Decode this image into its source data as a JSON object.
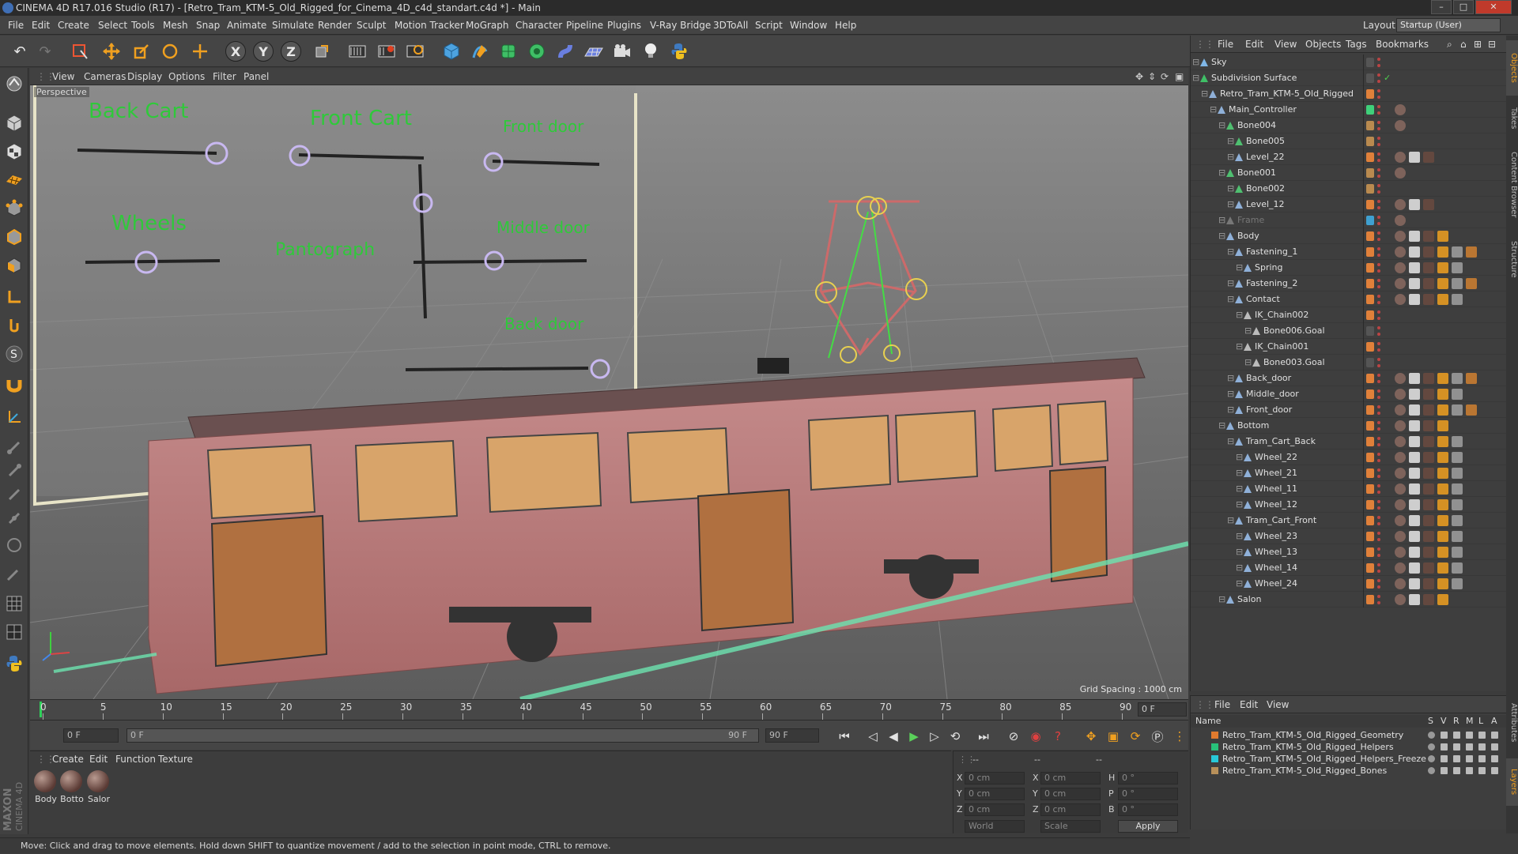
{
  "window": {
    "title": "CINEMA 4D R17.016 Studio (R17) - [Retro_Tram_KTM-5_Old_Rigged_for_Cinema_4D_c4d_standart.c4d *] - Main",
    "minimize": "–",
    "maximize": "□",
    "close": "✕"
  },
  "menu": {
    "items": [
      "File",
      "Edit",
      "Create",
      "Select",
      "Tools",
      "Mesh",
      "Snap",
      "Animate",
      "Simulate",
      "Render",
      "Sculpt",
      "Motion Tracker",
      "MoGraph",
      "Character",
      "Pipeline",
      "Plugins",
      "V-Ray Bridge",
      "3DToAll",
      "Script",
      "Window",
      "Help"
    ],
    "layout_label": "Layout:",
    "layout_value": "Startup (User)"
  },
  "toolbar": {
    "undo": "↶",
    "redo": "↷",
    "x_axis": "X",
    "y_axis": "Y",
    "z_axis": "Z"
  },
  "viewport": {
    "menu": [
      "View",
      "Cameras",
      "Display",
      "Options",
      "Filter",
      "Panel"
    ],
    "label": "Perspective",
    "grid_spacing": "Grid Spacing : 1000 cm",
    "controls": {
      "back_cart": "Back Cart",
      "front_cart": "Front Cart",
      "front_door": "Front door",
      "wheels": "Wheels",
      "pantograph": "Pantograph",
      "middle_door": "Middle door",
      "back_door": "Back door"
    }
  },
  "timeline": {
    "ticks": [
      "0",
      "5",
      "10",
      "15",
      "20",
      "25",
      "30",
      "35",
      "40",
      "45",
      "50",
      "55",
      "60",
      "65",
      "70",
      "75",
      "80",
      "85",
      "90"
    ],
    "current_frame": "0 F"
  },
  "playbar": {
    "start_field": "0 F",
    "range_start": "0 F",
    "range_end": "90 F",
    "end_field": "90 F"
  },
  "materials": {
    "menu": [
      "Create",
      "Edit",
      "Function",
      "Texture"
    ],
    "items": [
      "Body",
      "Botto",
      "Salor"
    ]
  },
  "coordinates": {
    "header1": "--",
    "header2": "--",
    "header3": "--",
    "rows": [
      {
        "l1": "X",
        "v1": "0 cm",
        "l2": "X",
        "v2": "0 cm",
        "l3": "H",
        "v3": "0 °"
      },
      {
        "l1": "Y",
        "v1": "0 cm",
        "l2": "Y",
        "v2": "0 cm",
        "l3": "P",
        "v3": "0 °"
      },
      {
        "l1": "Z",
        "v1": "0 cm",
        "l2": "Z",
        "v2": "0 cm",
        "l3": "B",
        "v3": "0 °"
      }
    ],
    "space": "World",
    "mode": "Scale",
    "apply": "Apply"
  },
  "status": "Move: Click and drag to move elements. Hold down SHIFT to quantize movement / add to the selection in point mode, CTRL to remove.",
  "objects": {
    "menu": [
      "File",
      "Edit",
      "View",
      "Objects",
      "Tags",
      "Bookmarks"
    ],
    "rows": [
      {
        "name": "Sky",
        "depth": 0,
        "icon": "#7fb6e6",
        "vis": "#555",
        "tags": 0
      },
      {
        "name": "Subdivision Surface",
        "depth": 0,
        "icon": "#3fbf66",
        "vis": "#555",
        "tags": 0,
        "check": "✓"
      },
      {
        "name": "Retro_Tram_KTM-5_Old_Rigged",
        "depth": 1,
        "icon": "#8fb0d8",
        "vis": "#e0803a",
        "tags": 0
      },
      {
        "name": "Main_Controller",
        "depth": 2,
        "icon": "#8fb0d8",
        "vis": "#3fd07a",
        "tags": 1
      },
      {
        "name": "Bone004",
        "depth": 3,
        "icon": "#4fbf70",
        "vis": "#b98a4f",
        "tags": 1
      },
      {
        "name": "Bone005",
        "depth": 4,
        "icon": "#4fbf70",
        "vis": "#b98a4f",
        "tags": 0
      },
      {
        "name": "Level_22",
        "depth": 4,
        "icon": "#8fb0d8",
        "vis": "#e0803a",
        "tags": 3
      },
      {
        "name": "Bone001",
        "depth": 3,
        "icon": "#4fbf70",
        "vis": "#b98a4f",
        "tags": 1
      },
      {
        "name": "Bone002",
        "depth": 4,
        "icon": "#4fbf70",
        "vis": "#b98a4f",
        "tags": 0
      },
      {
        "name": "Level_12",
        "depth": 4,
        "icon": "#8fb0d8",
        "vis": "#e0803a",
        "tags": 3
      },
      {
        "name": "Frame",
        "depth": 3,
        "icon": "#777",
        "vis": "#3fa0d0",
        "tags": 1,
        "dim": true
      },
      {
        "name": "Body",
        "depth": 3,
        "icon": "#8fb0d8",
        "vis": "#e0803a",
        "tags": 4
      },
      {
        "name": "Fastening_1",
        "depth": 4,
        "icon": "#8fb0d8",
        "vis": "#e0803a",
        "tags": 6
      },
      {
        "name": "Spring",
        "depth": 5,
        "icon": "#8fb0d8",
        "vis": "#e0803a",
        "tags": 5
      },
      {
        "name": "Fastening_2",
        "depth": 4,
        "icon": "#8fb0d8",
        "vis": "#e0803a",
        "tags": 6
      },
      {
        "name": "Contact",
        "depth": 4,
        "icon": "#8fb0d8",
        "vis": "#e0803a",
        "tags": 5
      },
      {
        "name": "IK_Chain002",
        "depth": 5,
        "icon": "#bbbbbb",
        "vis": "#e0803a",
        "tags": 0
      },
      {
        "name": "Bone006.Goal",
        "depth": 6,
        "icon": "#bbbbbb",
        "vis": "#555",
        "tags": 0
      },
      {
        "name": "IK_Chain001",
        "depth": 5,
        "icon": "#bbbbbb",
        "vis": "#e0803a",
        "tags": 0
      },
      {
        "name": "Bone003.Goal",
        "depth": 6,
        "icon": "#bbbbbb",
        "vis": "#555",
        "tags": 0
      },
      {
        "name": "Back_door",
        "depth": 4,
        "icon": "#8fb0d8",
        "vis": "#e0803a",
        "tags": 6
      },
      {
        "name": "Middle_door",
        "depth": 4,
        "icon": "#8fb0d8",
        "vis": "#e0803a",
        "tags": 5
      },
      {
        "name": "Front_door",
        "depth": 4,
        "icon": "#8fb0d8",
        "vis": "#e0803a",
        "tags": 6
      },
      {
        "name": "Bottom",
        "depth": 3,
        "icon": "#8fb0d8",
        "vis": "#e0803a",
        "tags": 4
      },
      {
        "name": "Tram_Cart_Back",
        "depth": 4,
        "icon": "#8fb0d8",
        "vis": "#e0803a",
        "tags": 5
      },
      {
        "name": "Wheel_22",
        "depth": 5,
        "icon": "#8fb0d8",
        "vis": "#e0803a",
        "tags": 5
      },
      {
        "name": "Wheel_21",
        "depth": 5,
        "icon": "#8fb0d8",
        "vis": "#e0803a",
        "tags": 5
      },
      {
        "name": "Wheel_11",
        "depth": 5,
        "icon": "#8fb0d8",
        "vis": "#e0803a",
        "tags": 5
      },
      {
        "name": "Wheel_12",
        "depth": 5,
        "icon": "#8fb0d8",
        "vis": "#e0803a",
        "tags": 5
      },
      {
        "name": "Tram_Cart_Front",
        "depth": 4,
        "icon": "#8fb0d8",
        "vis": "#e0803a",
        "tags": 5
      },
      {
        "name": "Wheel_23",
        "depth": 5,
        "icon": "#8fb0d8",
        "vis": "#e0803a",
        "tags": 5
      },
      {
        "name": "Wheel_13",
        "depth": 5,
        "icon": "#8fb0d8",
        "vis": "#e0803a",
        "tags": 5
      },
      {
        "name": "Wheel_14",
        "depth": 5,
        "icon": "#8fb0d8",
        "vis": "#e0803a",
        "tags": 5
      },
      {
        "name": "Wheel_24",
        "depth": 5,
        "icon": "#8fb0d8",
        "vis": "#e0803a",
        "tags": 5
      },
      {
        "name": "Salon",
        "depth": 3,
        "icon": "#8fb0d8",
        "vis": "#e0803a",
        "tags": 4
      }
    ]
  },
  "layers": {
    "menu": [
      "File",
      "Edit",
      "View"
    ],
    "header": {
      "name": "Name",
      "cols": [
        "S",
        "V",
        "R",
        "M",
        "L",
        "A"
      ]
    },
    "rows": [
      {
        "name": "Retro_Tram_KTM-5_Old_Rigged_Geometry",
        "color": "#e07a2e"
      },
      {
        "name": "Retro_Tram_KTM-5_Old_Rigged_Helpers",
        "color": "#28c07a"
      },
      {
        "name": "Retro_Tram_KTM-5_Old_Rigged_Helpers_Freeze",
        "color": "#28c8d8"
      },
      {
        "name": "Retro_Tram_KTM-5_Old_Rigged_Bones",
        "color": "#b8905a"
      }
    ]
  },
  "side_tabs": [
    "Objects",
    "Takes",
    "Content Browser",
    "Structure",
    "Attributes",
    "Layers"
  ],
  "colors": {
    "accent_orange": "#f0a020",
    "control_green": "#2fc93a",
    "ui_dark": "#3c3c3c"
  }
}
